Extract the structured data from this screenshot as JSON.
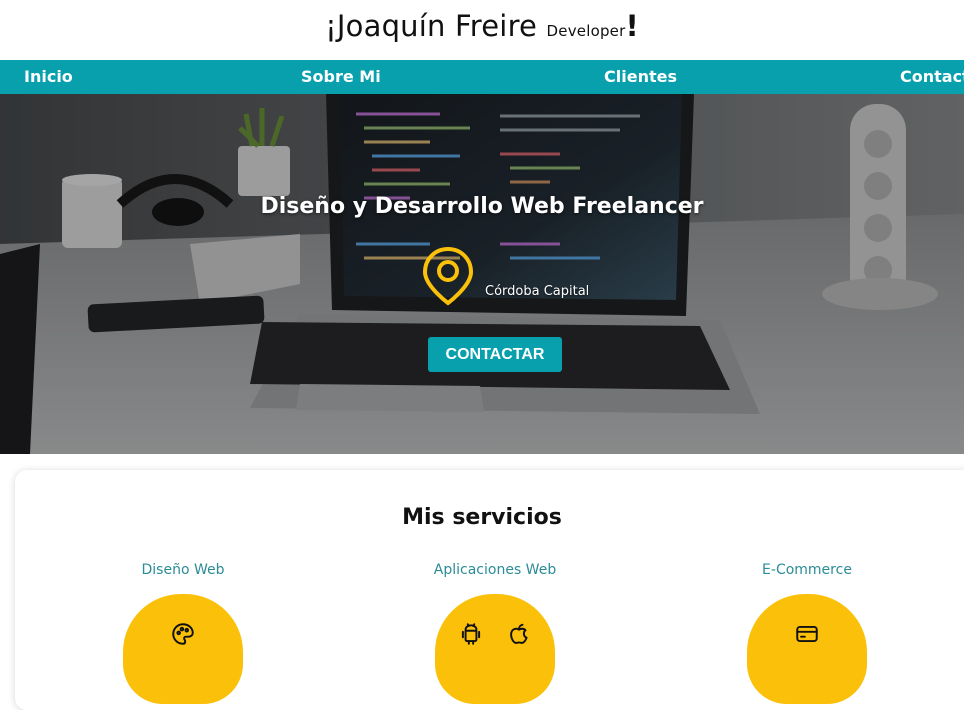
{
  "header": {
    "title_main": "¡Joaquín Freire",
    "title_sub": "Developer",
    "title_end": "!"
  },
  "nav": {
    "items": [
      {
        "label": "Inicio"
      },
      {
        "label": "Sobre Mi"
      },
      {
        "label": "Clientes"
      },
      {
        "label": "Contacto"
      }
    ]
  },
  "hero": {
    "heading": "Diseño y Desarrollo Web Freelancer",
    "location": "Córdoba Capital",
    "cta_label": "CONTACTAR"
  },
  "services": {
    "title": "Mis servicios",
    "items": [
      {
        "label": "Diseño Web",
        "icons": [
          "palette-icon"
        ]
      },
      {
        "label": "Aplicaciones Web",
        "icons": [
          "android-icon",
          "apple-icon"
        ]
      },
      {
        "label": "E-Commerce",
        "icons": [
          "credit-card-icon"
        ]
      }
    ]
  },
  "colors": {
    "nav_bg": "#08a0ad",
    "accent_yellow": "#fbc10a",
    "service_label": "#2b8c96"
  }
}
